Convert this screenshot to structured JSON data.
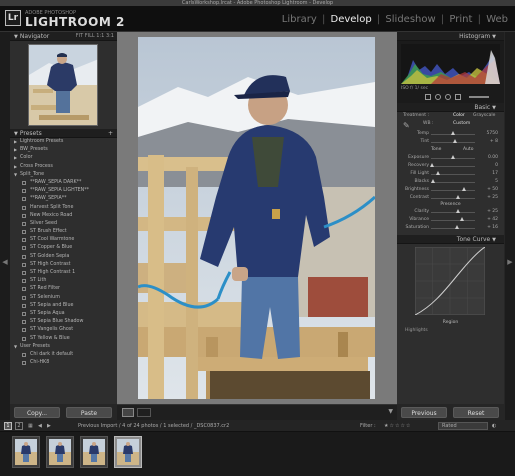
{
  "window": {
    "title": "CarlsWorkshop.lrcat - Adobe Photoshop Lightroom - Develop"
  },
  "identity_plate": {
    "logo_badge": "Lr",
    "product_small": "ADOBE PHOTOSHOP",
    "product_name": "LIGHTROOM 2"
  },
  "modules": [
    {
      "label": "Library",
      "active": false
    },
    {
      "label": "Develop",
      "active": true
    },
    {
      "label": "Slideshow",
      "active": false
    },
    {
      "label": "Print",
      "active": false
    },
    {
      "label": "Web",
      "active": false
    }
  ],
  "navigator": {
    "title": "Navigator",
    "options": "FIT  FILL  1:1  3:1"
  },
  "presets": {
    "title": "Presets",
    "items": [
      {
        "label": "Lightroom Presets",
        "level": "folder"
      },
      {
        "label": "BW_Presets",
        "level": "folder"
      },
      {
        "label": "Color",
        "level": "folder"
      },
      {
        "label": "Cross Process",
        "level": "folder"
      },
      {
        "label": "Split_Tone",
        "level": "folder",
        "open": true
      },
      {
        "label": "**RAW_SEPIA DARK**",
        "level": "sub"
      },
      {
        "label": "**RAW_SEPIA LIGHTEN**",
        "level": "sub"
      },
      {
        "label": "**RAW_SEPIA**",
        "level": "sub"
      },
      {
        "label": "Harvest Split Tone",
        "level": "sub"
      },
      {
        "label": "New Mexico Road",
        "level": "sub"
      },
      {
        "label": "Silver Seed",
        "level": "sub"
      },
      {
        "label": "ST Brush Effect",
        "level": "sub"
      },
      {
        "label": "ST Cool Warmtone",
        "level": "sub"
      },
      {
        "label": "ST Copper & Blue",
        "level": "sub"
      },
      {
        "label": "ST Golden Sepia",
        "level": "sub"
      },
      {
        "label": "ST High Contrast",
        "level": "sub"
      },
      {
        "label": "ST High Contrast 1",
        "level": "sub"
      },
      {
        "label": "ST Lith",
        "level": "sub"
      },
      {
        "label": "ST Red Filter",
        "level": "sub"
      },
      {
        "label": "ST Selenium",
        "level": "sub"
      },
      {
        "label": "ST Sepia and Blue",
        "level": "sub"
      },
      {
        "label": "ST Sepia Aqua",
        "level": "sub"
      },
      {
        "label": "ST Sepia Blue Shadow",
        "level": "sub"
      },
      {
        "label": "ST Vangelis Ghost",
        "level": "sub"
      },
      {
        "label": "ST Yellow & Blue",
        "level": "sub"
      },
      {
        "label": "User Presets",
        "level": "folder",
        "open": true
      },
      {
        "label": "Chi dark it default",
        "level": "sub"
      },
      {
        "label": "Chi-HK8",
        "level": "sub"
      }
    ]
  },
  "copy_paste": {
    "copy": "Copy...",
    "paste": "Paste"
  },
  "histogram": {
    "title": "Histogram"
  },
  "basic": {
    "title": "Basic",
    "treatment_label": "Treatment :",
    "color_label": "Color",
    "grayscale_label": "Grayscale",
    "wb_label": "WB :",
    "wb_value": "Custom",
    "tone_label": "Tone",
    "auto_label": "Auto",
    "presence_label": "Presence",
    "sliders": [
      {
        "name": "temp",
        "label": "Temp",
        "value": "5750",
        "pos": 0.5
      },
      {
        "name": "tint",
        "label": "Tint",
        "value": "+ 8",
        "pos": 0.55
      },
      {
        "name": "exposure",
        "label": "Exposure",
        "value": "0.00",
        "pos": 0.5
      },
      {
        "name": "recovery",
        "label": "Recovery",
        "value": "0",
        "pos": 0.02
      },
      {
        "name": "fill-light",
        "label": "Fill Light",
        "value": "17",
        "pos": 0.17
      },
      {
        "name": "blacks",
        "label": "Blacks",
        "value": "5",
        "pos": 0.05
      },
      {
        "name": "brightness",
        "label": "Brightness",
        "value": "+ 50",
        "pos": 0.75
      },
      {
        "name": "contrast",
        "label": "Contrast",
        "value": "+ 25",
        "pos": 0.62
      },
      {
        "name": "clarity",
        "label": "Clarity",
        "value": "+ 25",
        "pos": 0.62
      },
      {
        "name": "vibrance",
        "label": "Vibrance",
        "value": "+ 42",
        "pos": 0.71
      },
      {
        "name": "saturation",
        "label": "Saturation",
        "value": "+ 16",
        "pos": 0.58
      }
    ]
  },
  "tone_curve": {
    "title": "Tone Curve",
    "region_label": "Region",
    "region_sliders": [
      "Highlights",
      "Lights",
      "Darks"
    ]
  },
  "previous_reset": {
    "previous": "Previous",
    "reset": "Reset"
  },
  "filmstrip": {
    "page1": "1",
    "page2": "2",
    "source": "Previous Import / 4 of 24 photos / 1 selected / _DSC0837.cr2",
    "filter_label": "Filter :",
    "rated_label": "Rated",
    "thumbnails": [
      {
        "selected": false
      },
      {
        "selected": false
      },
      {
        "selected": false
      },
      {
        "selected": true
      }
    ]
  }
}
